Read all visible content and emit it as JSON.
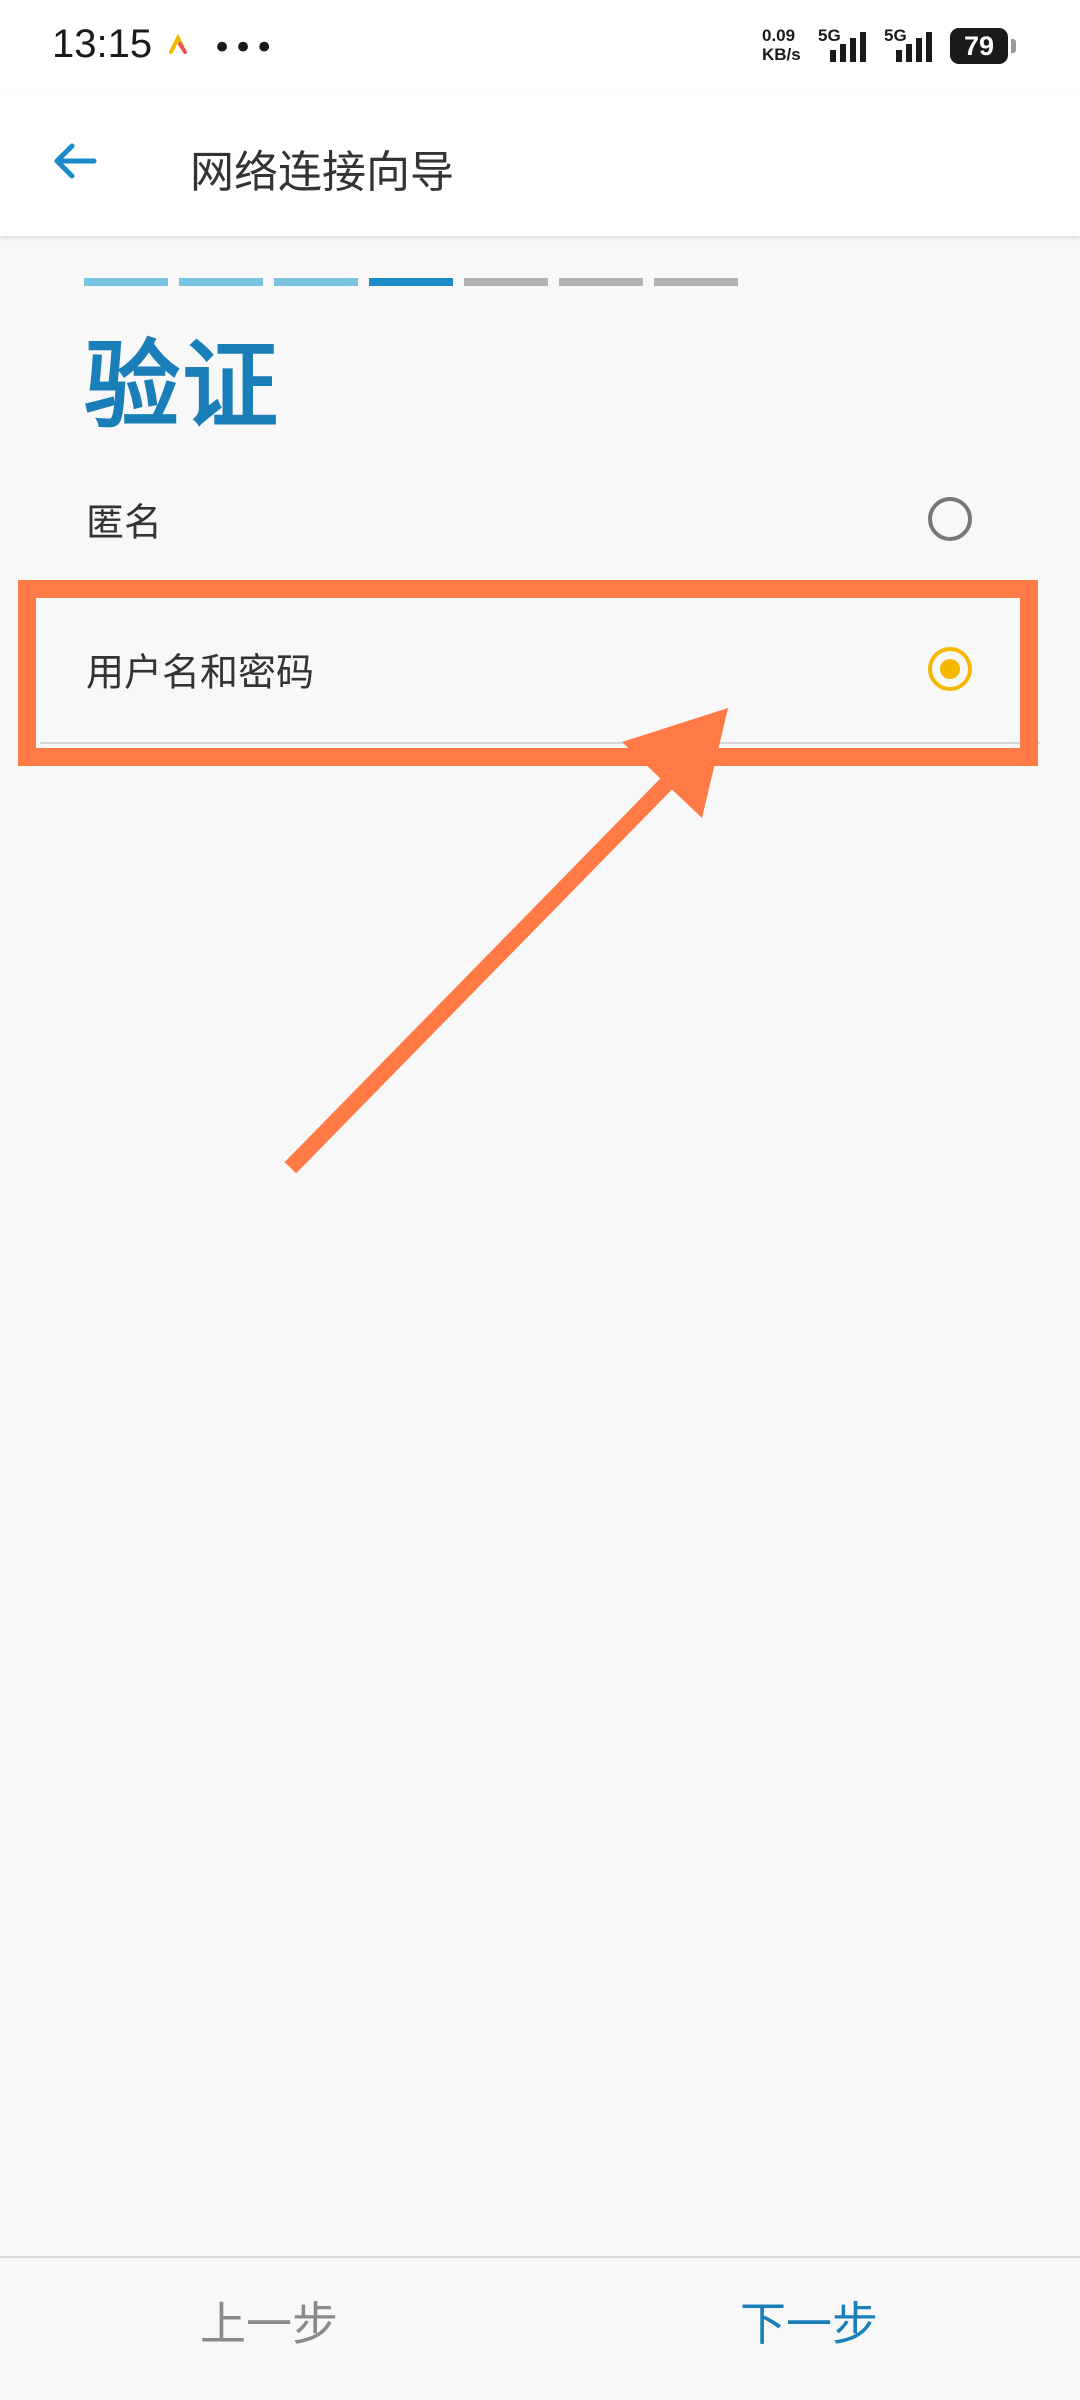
{
  "status_bar": {
    "time": "13:15",
    "net_speed": "0.09 KB/s",
    "sim1": "5G",
    "sim2": "5G",
    "battery": "79"
  },
  "app_bar": {
    "title": "网络连接向导"
  },
  "progress": {
    "total_steps": 7,
    "current_step": 4,
    "completed_color": "#7cc4e3",
    "current_color": "#1a8bc7",
    "pending_color": "#b3b3b3"
  },
  "page": {
    "title": "验证",
    "options": [
      {
        "label": "匿名",
        "selected": false
      },
      {
        "label": "用户名和密码",
        "selected": true
      }
    ]
  },
  "footer": {
    "prev_label": "上一步",
    "next_label": "下一步"
  },
  "colors": {
    "accent": "#1a7eb8",
    "radio_selected": "#f5b700",
    "annotation": "#ff7a45"
  }
}
